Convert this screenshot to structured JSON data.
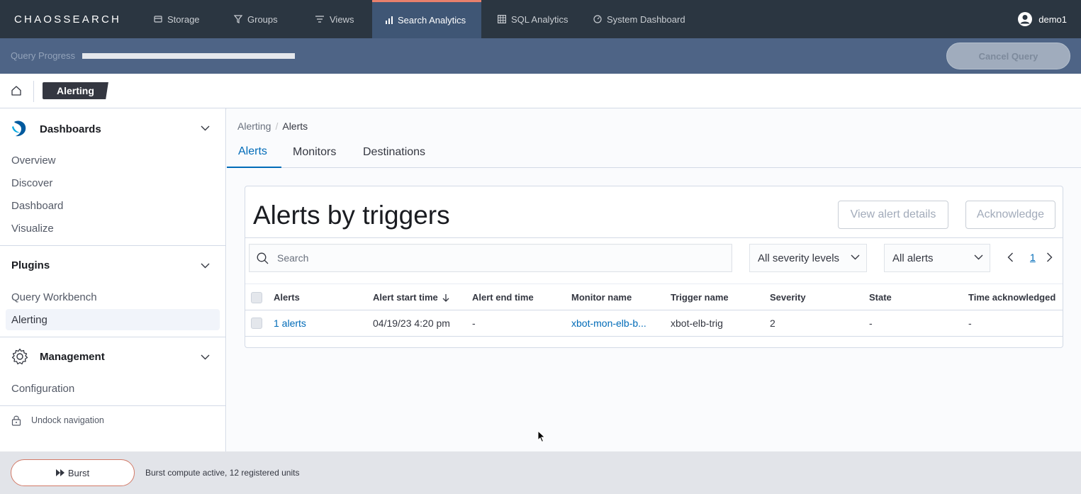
{
  "brand": {
    "name": "CHAOSSEARCH"
  },
  "topnav": {
    "items": [
      {
        "label": "Storage",
        "icon": "storage-icon"
      },
      {
        "label": "Groups",
        "icon": "filter-icon"
      },
      {
        "label": "Views",
        "icon": "list-icon"
      },
      {
        "label": "Search Analytics",
        "icon": "bar-chart-icon",
        "active": true
      },
      {
        "label": "SQL Analytics",
        "icon": "table-icon"
      },
      {
        "label": "System Dashboard",
        "icon": "gauge-icon"
      }
    ],
    "user": "demo1"
  },
  "query": {
    "label": "Query Progress",
    "progress": 1.0,
    "cancel_label": "Cancel Query"
  },
  "header": {
    "breadcrumb_current": "Alerting"
  },
  "sidebar": {
    "dashboards": {
      "title": "Dashboards",
      "items": [
        "Overview",
        "Discover",
        "Dashboard",
        "Visualize"
      ]
    },
    "plugins": {
      "title": "Plugins",
      "items": [
        "Query Workbench",
        "Alerting"
      ]
    },
    "management": {
      "title": "Management",
      "items": [
        "Configuration"
      ]
    },
    "undock_label": "Undock navigation"
  },
  "main": {
    "crumbs": [
      "Alerting",
      "Alerts"
    ],
    "tabs": [
      "Alerts",
      "Monitors",
      "Destinations"
    ],
    "panel": {
      "title": "Alerts by triggers",
      "view_details_label": "View alert details",
      "acknowledge_label": "Acknowledge",
      "search_placeholder": "Search",
      "severity_select": "All severity levels",
      "alerts_select": "All alerts",
      "page": "1",
      "columns": [
        "Alerts",
        "Alert start time",
        "Alert end time",
        "Monitor name",
        "Trigger name",
        "Severity",
        "State",
        "Time acknowledged"
      ],
      "rows": [
        [
          "1 alerts",
          "04/19/23 4:20 pm",
          "-",
          "xbot-mon-elb-b...",
          "xbot-elb-trig",
          "2",
          "-",
          "-"
        ]
      ]
    }
  },
  "footer": {
    "burst_label": "Burst",
    "status": "Burst compute active, 12 registered units"
  }
}
